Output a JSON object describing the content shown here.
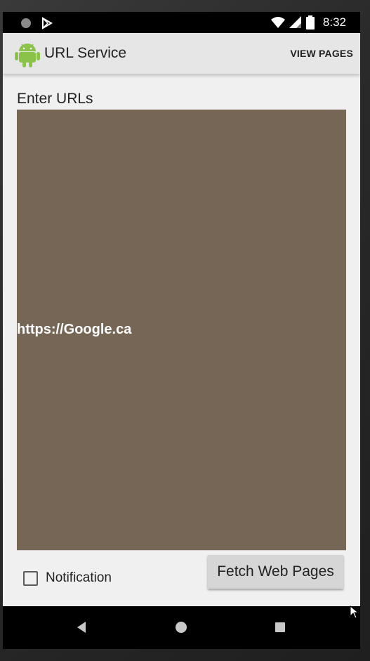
{
  "status_bar": {
    "time": "8:32",
    "icons": [
      "sync-circle-icon",
      "play-store-icon",
      "wifi-icon",
      "signal-icon",
      "battery-icon"
    ]
  },
  "app_bar": {
    "title": "URL Service",
    "logo": "android-logo-icon",
    "action_label": "VIEW PAGES"
  },
  "form": {
    "urls_label": "Enter URLs",
    "urls_value": "https://Google.ca",
    "notification_label": "Notification",
    "notification_checked": false,
    "fetch_button_label": "Fetch Web Pages"
  },
  "nav_bar": {
    "icons": [
      "back-icon",
      "home-icon",
      "recents-icon"
    ]
  },
  "colors": {
    "url_area_bg": "#766656",
    "app_bar_bg": "#e6e6e6",
    "screen_bg": "#f0f0f0"
  }
}
